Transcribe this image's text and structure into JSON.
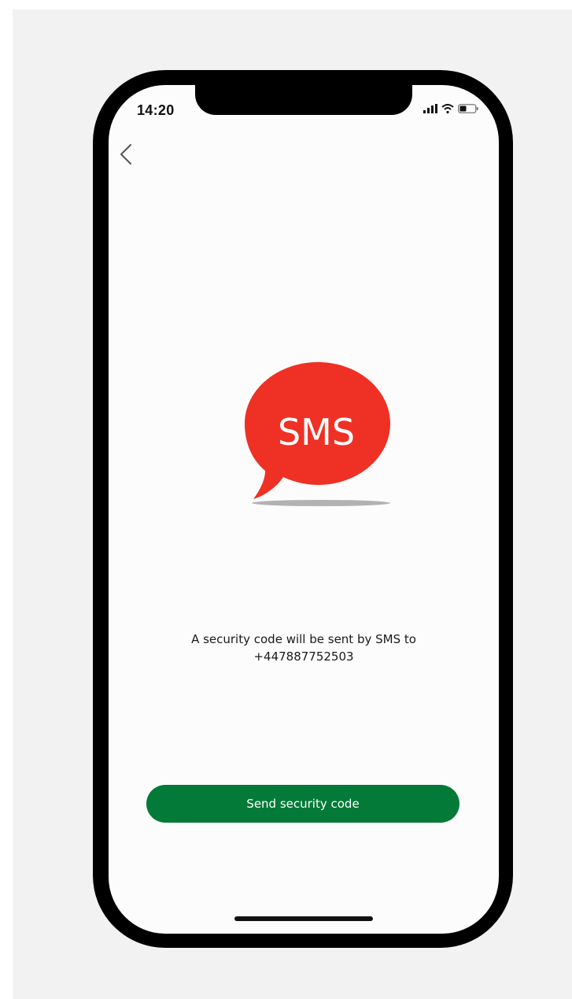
{
  "status_bar": {
    "time": "14:20",
    "icons": [
      "signal-icon",
      "wifi-icon",
      "battery-icon"
    ]
  },
  "nav": {
    "back_icon": "chevron-left-icon"
  },
  "logo": {
    "text": "SMS",
    "bubble_color": "#ee3124"
  },
  "message": {
    "line1": "A security code will be sent by SMS to",
    "phone_number": "+447887752503"
  },
  "actions": {
    "send_label": "Send security code",
    "send_color": "#037a37"
  }
}
